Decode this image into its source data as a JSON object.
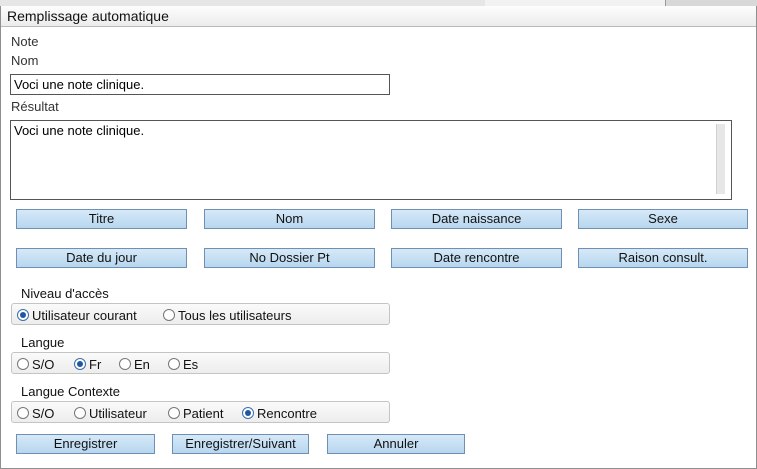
{
  "window": {
    "title": "Remplissage automatique"
  },
  "note": {
    "section_label": "Note",
    "name_label": "Nom",
    "name_value": "Voci une note clinique.",
    "result_label": "Résultat",
    "result_value": "Voci une note clinique."
  },
  "insert_buttons": [
    {
      "label": "Titre"
    },
    {
      "label": "Nom"
    },
    {
      "label": "Date naissance"
    },
    {
      "label": "Sexe"
    },
    {
      "label": "Date du jour"
    },
    {
      "label": "No Dossier Pt"
    },
    {
      "label": "Date rencontre"
    },
    {
      "label": "Raison consult."
    }
  ],
  "access_level": {
    "label": "Niveau d'accès",
    "options": [
      {
        "label": "Utilisateur courant",
        "selected": true
      },
      {
        "label": "Tous les utilisateurs",
        "selected": false
      }
    ]
  },
  "language": {
    "label": "Langue",
    "options": [
      {
        "label": "S/O",
        "selected": false
      },
      {
        "label": "Fr",
        "selected": true
      },
      {
        "label": "En",
        "selected": false
      },
      {
        "label": "Es",
        "selected": false
      }
    ]
  },
  "language_context": {
    "label": "Langue Contexte",
    "options": [
      {
        "label": "S/O",
        "selected": false
      },
      {
        "label": "Utilisateur",
        "selected": false
      },
      {
        "label": "Patient",
        "selected": false
      },
      {
        "label": "Rencontre",
        "selected": true
      }
    ]
  },
  "actions": {
    "save_label": "Enregistrer",
    "save_next_label": "Enregistrer/Suivant",
    "cancel_label": "Annuler"
  }
}
